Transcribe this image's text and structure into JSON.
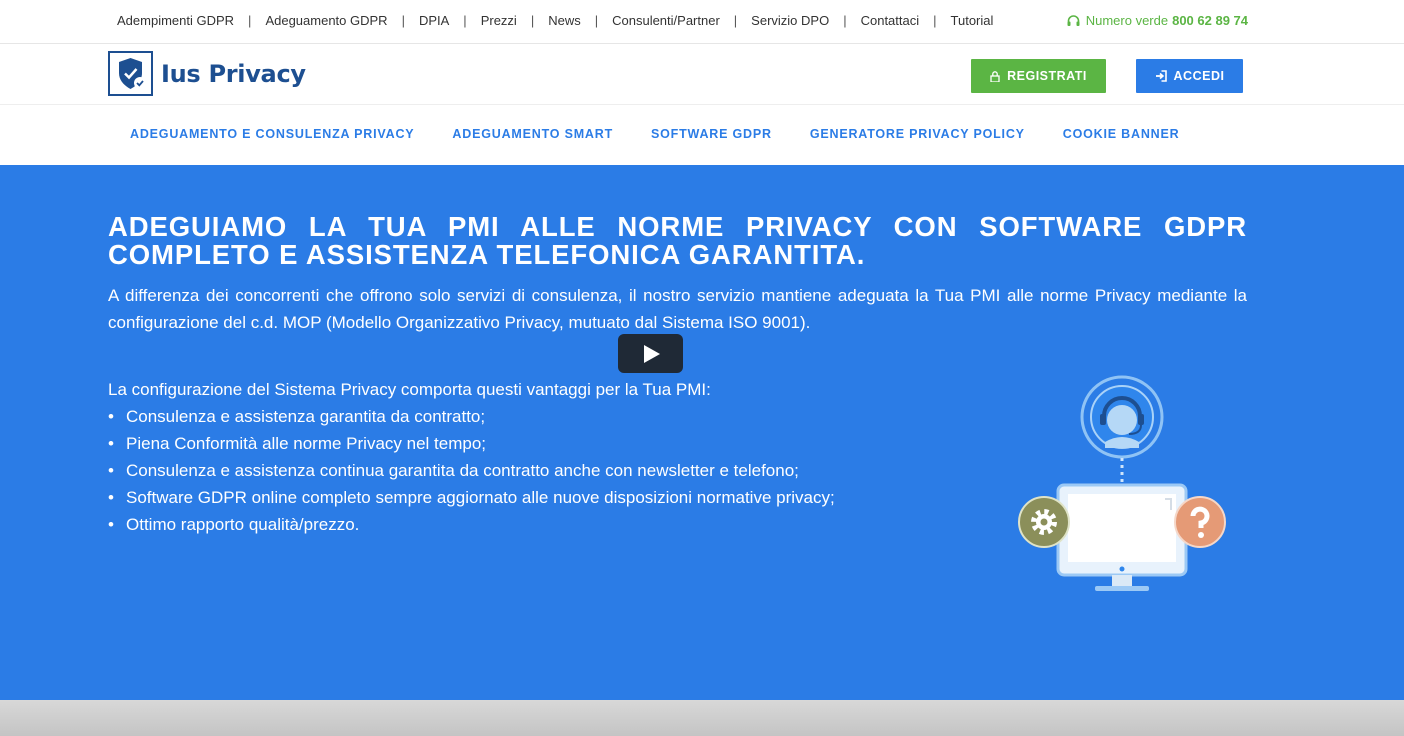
{
  "topbar": {
    "links": [
      "Adempimenti GDPR",
      "Adeguamento GDPR",
      "DPIA",
      "Prezzi",
      "News",
      "Consulenti/Partner",
      "Servizio DPO",
      "Contattaci",
      "Tutorial"
    ],
    "separator": "|",
    "phone_label": "Numero verde",
    "phone_number": "800 62 89 74",
    "phone_icon": "headset-icon"
  },
  "header": {
    "logo_text": "Ius Privacy",
    "logo_icon": "shield-check-icon",
    "register_label": "REGISTRATI",
    "register_icon": "lock-icon",
    "login_label": "ACCEDI",
    "login_icon": "sign-in-icon"
  },
  "nav": {
    "items": [
      "ADEGUAMENTO E CONSULENZA PRIVACY",
      "ADEGUAMENTO SMART",
      "SOFTWARE GDPR",
      "GENERATORE PRIVACY POLICY",
      "COOKIE BANNER"
    ]
  },
  "hero": {
    "title": "ADEGUIAMO LA TUA PMI ALLE NORME PRIVACY CON SOFTWARE GDPR COMPLETO E ASSISTENZA TELEFONICA GARANTITA.",
    "intro": "A differenza dei concorrenti che offrono solo servizi di consulenza, il nostro servizio mantiene adeguata la Tua PMI alle norme Privacy mediante la configurazione del c.d. MOP (Modello Organizzativo Privacy, mutuato dal Sistema ISO 9001).",
    "benefits_title": "La configurazione del Sistema Privacy comporta questi vantaggi per la Tua PMI:",
    "benefits": [
      "Consulenza e assistenza garantita da contratto;",
      "Piena Conformità alle norme Privacy nel tempo;",
      "Consulenza e assistenza continua garantita da contratto anche con newsletter e telefono;",
      "Software GDPR online completo sempre aggiornato alle nuove disposizioni normative privacy;",
      "Ottimo rapporto qualità/prezzo."
    ],
    "play_icon": "play-icon"
  },
  "colors": {
    "brand_blue": "#2b7ce6",
    "green": "#5bb544",
    "logo_navy": "#1d4f91"
  }
}
